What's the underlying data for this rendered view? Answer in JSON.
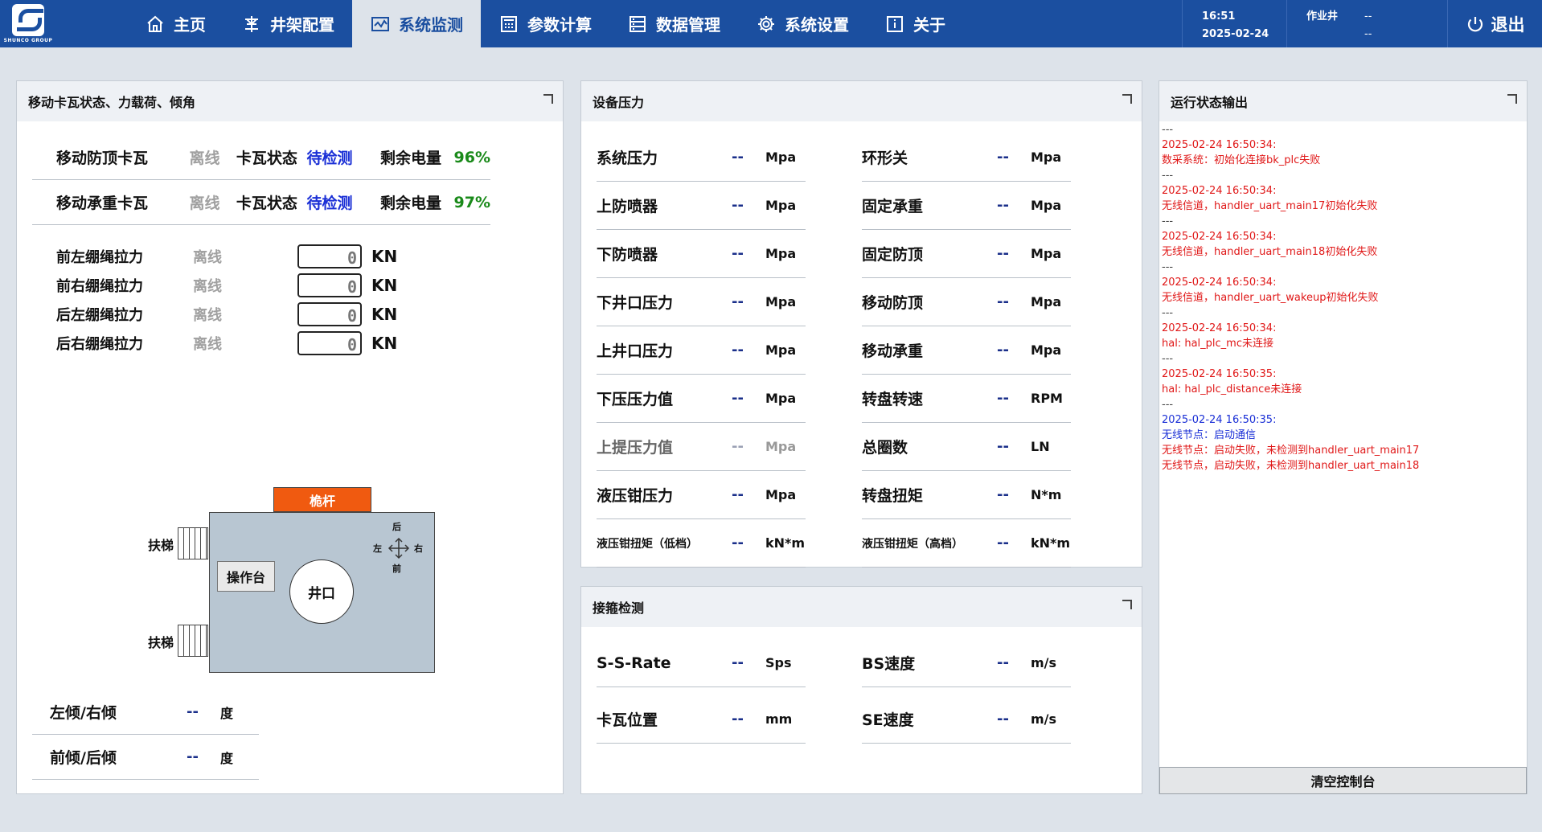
{
  "nav": {
    "brand": "SHUNCO GROUP",
    "items": [
      {
        "label": "主页",
        "icon": "home-icon"
      },
      {
        "label": "井架配置",
        "icon": "rig-config-icon"
      },
      {
        "label": "系统监测",
        "icon": "monitor-icon"
      },
      {
        "label": "参数计算",
        "icon": "calculator-icon"
      },
      {
        "label": "数据管理",
        "icon": "database-icon"
      },
      {
        "label": "系统设置",
        "icon": "gear-icon"
      },
      {
        "label": "关于",
        "icon": "info-icon"
      }
    ],
    "active": "系统监测",
    "time": "16:51",
    "date": "2025-02-24",
    "well_label": "作业井",
    "well_value1": "--",
    "well_value2": "--",
    "logout": "退出"
  },
  "left_panel": {
    "title": "移动卡瓦状态、力载荷、倾角",
    "slips": [
      {
        "name": "移动防顶卡瓦",
        "conn": "离线",
        "state_label": "卡瓦状态",
        "state": "待检测",
        "battery_label": "剩余电量",
        "battery": "96%"
      },
      {
        "name": "移动承重卡瓦",
        "conn": "离线",
        "state_label": "卡瓦状态",
        "state": "待检测",
        "battery_label": "剩余电量",
        "battery": "97%"
      }
    ],
    "tensions": [
      {
        "name": "前左绷绳拉力",
        "status": "离线",
        "value": "0",
        "unit": "KN"
      },
      {
        "name": "前右绷绳拉力",
        "status": "离线",
        "value": "0",
        "unit": "KN"
      },
      {
        "name": "后左绷绳拉力",
        "status": "离线",
        "value": "0",
        "unit": "KN"
      },
      {
        "name": "后右绷绳拉力",
        "status": "离线",
        "value": "0",
        "unit": "KN"
      }
    ],
    "diagram": {
      "kelly": "桅杆",
      "ladder1": "扶梯",
      "ladder2": "扶梯",
      "console": "操作台",
      "wellhead": "井口",
      "dir_back": "后",
      "dir_front": "前",
      "dir_left": "左",
      "dir_right": "右"
    },
    "tilts": [
      {
        "label": "左倾/右倾",
        "value": "--",
        "unit": "度"
      },
      {
        "label": "前倾/后倾",
        "value": "--",
        "unit": "度"
      }
    ]
  },
  "pressure_panel": {
    "title": "设备压力",
    "left": [
      {
        "label": "系统压力",
        "value": "--",
        "unit": "Mpa"
      },
      {
        "label": "上防喷器",
        "value": "--",
        "unit": "Mpa"
      },
      {
        "label": "下防喷器",
        "value": "--",
        "unit": "Mpa"
      },
      {
        "label": "下井口压力",
        "value": "--",
        "unit": "Mpa"
      },
      {
        "label": "上井口压力",
        "value": "--",
        "unit": "Mpa"
      },
      {
        "label": "下压压力值",
        "value": "--",
        "unit": "Mpa"
      },
      {
        "label": "上提压力值",
        "value": "--",
        "unit": "Mpa"
      },
      {
        "label": "液压钳压力",
        "value": "--",
        "unit": "Mpa"
      },
      {
        "label": "液压钳扭矩（低档）",
        "value": "--",
        "unit": "kN*m"
      }
    ],
    "right": [
      {
        "label": "环形关",
        "value": "--",
        "unit": "Mpa"
      },
      {
        "label": "固定承重",
        "value": "--",
        "unit": "Mpa"
      },
      {
        "label": "固定防顶",
        "value": "--",
        "unit": "Mpa"
      },
      {
        "label": "移动防顶",
        "value": "--",
        "unit": "Mpa"
      },
      {
        "label": "移动承重",
        "value": "--",
        "unit": "Mpa"
      },
      {
        "label": "转盘转速",
        "value": "--",
        "unit": "RPM"
      },
      {
        "label": "总圈数",
        "value": "--",
        "unit": "LN"
      },
      {
        "label": "转盘扭矩",
        "value": "--",
        "unit": "N*m"
      },
      {
        "label": "液压钳扭矩（高档）",
        "value": "--",
        "unit": "kN*m"
      }
    ]
  },
  "collar_panel": {
    "title": "接箍检测",
    "left": [
      {
        "label": "S-S-Rate",
        "value": "--",
        "unit": "Sps"
      },
      {
        "label": "卡瓦位置",
        "value": "--",
        "unit": "mm"
      }
    ],
    "right": [
      {
        "label": "BS速度",
        "value": "--",
        "unit": "m/s"
      },
      {
        "label": "SE速度",
        "value": "--",
        "unit": "m/s"
      }
    ]
  },
  "output_panel": {
    "title": "运行状态输出",
    "lines": [
      {
        "text": "---",
        "kind": "sep"
      },
      {
        "text": "2025-02-24 16:50:34:",
        "kind": "red"
      },
      {
        "text": "数采系统：初始化连接bk_plc失败",
        "kind": "red"
      },
      {
        "text": "---",
        "kind": "sep"
      },
      {
        "text": "2025-02-24 16:50:34:",
        "kind": "red"
      },
      {
        "text": "无线信道，handler_uart_main17初始化失败",
        "kind": "red"
      },
      {
        "text": "---",
        "kind": "sep"
      },
      {
        "text": "2025-02-24 16:50:34:",
        "kind": "red"
      },
      {
        "text": "无线信道，handler_uart_main18初始化失败",
        "kind": "red"
      },
      {
        "text": "---",
        "kind": "sep"
      },
      {
        "text": "2025-02-24 16:50:34:",
        "kind": "red"
      },
      {
        "text": "无线信道，handler_uart_wakeup初始化失败",
        "kind": "red"
      },
      {
        "text": "---",
        "kind": "sep"
      },
      {
        "text": "2025-02-24 16:50:34:",
        "kind": "red"
      },
      {
        "text": "hal: hal_plc_mc未连接",
        "kind": "red"
      },
      {
        "text": "---",
        "kind": "sep"
      },
      {
        "text": "2025-02-24 16:50:35:",
        "kind": "red"
      },
      {
        "text": "hal: hal_plc_distance未连接",
        "kind": "red"
      },
      {
        "text": "---",
        "kind": "sep"
      },
      {
        "text": "2025-02-24 16:50:35:",
        "kind": "blu"
      },
      {
        "text": "无线节点：启动通信",
        "kind": "blu"
      },
      {
        "text": "无线节点：启动失败，未检测到handler_uart_main17",
        "kind": "red"
      },
      {
        "text": "无线节点，启动失败，未检测到handler_uart_main18",
        "kind": "red"
      }
    ],
    "clear_button": "清空控制台"
  },
  "colors": {
    "nav_bg": "#1b4fa0",
    "accent_orange": "#f05a10",
    "status_blue": "#1a2fd6",
    "status_green": "#1a8a1a",
    "error_red": "#e01818"
  }
}
